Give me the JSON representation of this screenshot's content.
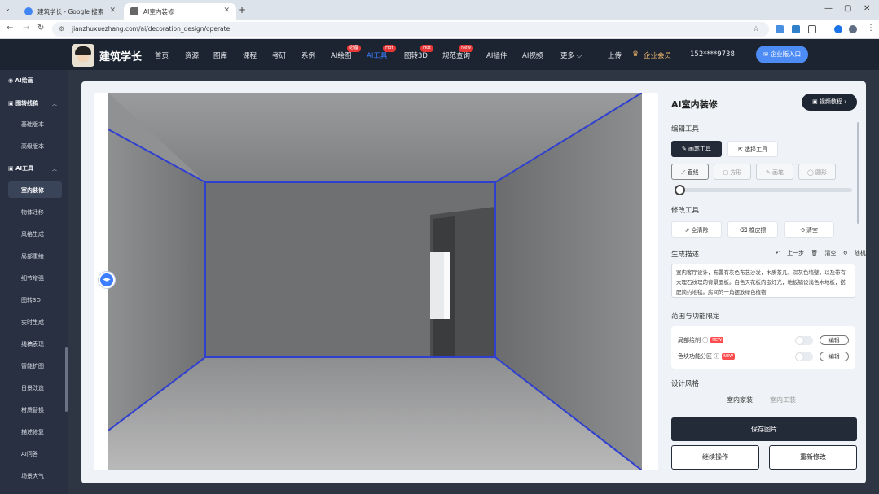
{
  "browser": {
    "tabs": [
      {
        "title": "建筑学长 - Google 搜索"
      },
      {
        "title": "AI室内装修"
      }
    ],
    "url": "jianzhuxuezhang.com/ai/decoration_design/operate"
  },
  "header": {
    "brand": "建筑学长",
    "menu": [
      {
        "label": "首页"
      },
      {
        "label": "资源"
      },
      {
        "label": "图库"
      },
      {
        "label": "课程"
      },
      {
        "label": "考研"
      },
      {
        "label": "系例"
      },
      {
        "label": "AI绘图",
        "badge": "必备"
      },
      {
        "label": "AI工具",
        "badge": "Hot",
        "active": true
      },
      {
        "label": "图转3D",
        "badge": "Hot"
      },
      {
        "label": "规范查询",
        "badge": "New"
      },
      {
        "label": "AI插件"
      },
      {
        "label": "AI视频"
      },
      {
        "label": "更多 ⌵"
      }
    ],
    "upload": "上传",
    "vip": "企业会员",
    "phone": "152****9738",
    "enter_button": "企业版入口"
  },
  "sidebar": {
    "ai_draw": "AI绘画",
    "group1": {
      "label": "图转线稿",
      "items": [
        "基础版本",
        "高级版本"
      ]
    },
    "group2": {
      "label": "AI工具",
      "items": [
        "室内装修",
        "物体迁移",
        "风格生成",
        "局部重绘",
        "细节增强",
        "图转3D",
        "实时生成",
        "线稿表现",
        "智能扩图",
        "日景改造",
        "材质替换",
        "描述修复",
        "AI问答",
        "场景大气"
      ]
    }
  },
  "panel": {
    "title": "AI室内装修",
    "video_button": "视频教程",
    "edit_tools": {
      "label": "编辑工具",
      "paint": "画笔工具",
      "select": "选择工具",
      "shapes": [
        "直线",
        "方形",
        "画笔",
        "圆形"
      ]
    },
    "modify_tools": {
      "label": "修改工具",
      "buttons": [
        "全清除",
        "橡皮擦",
        "清空"
      ]
    },
    "description": {
      "label": "生成描述",
      "undo": "上一步",
      "clear": "清空",
      "random": "随机",
      "text": "室内客厅设计，布置有灰色布艺沙发，木质茶几，深灰色墙壁，以及带有大理石纹理的背景面板。白色天花板内嵌灯光，地板铺设浅色木地板，搭配简约地毯。房间的一角摆放绿色植物"
    },
    "scope": {
      "label": "范围与功能限定",
      "rows": [
        {
          "label": "局部绘制",
          "tag": "NEW",
          "edit": "编辑"
        },
        {
          "label": "色块功能分区",
          "tag": "NEW",
          "edit": "编辑"
        }
      ]
    },
    "style": {
      "label": "设计风格",
      "tabs": [
        "室内家装",
        "室内工装"
      ]
    },
    "save": "保存图片",
    "continue": "继续操作",
    "redo": "重新修改"
  }
}
